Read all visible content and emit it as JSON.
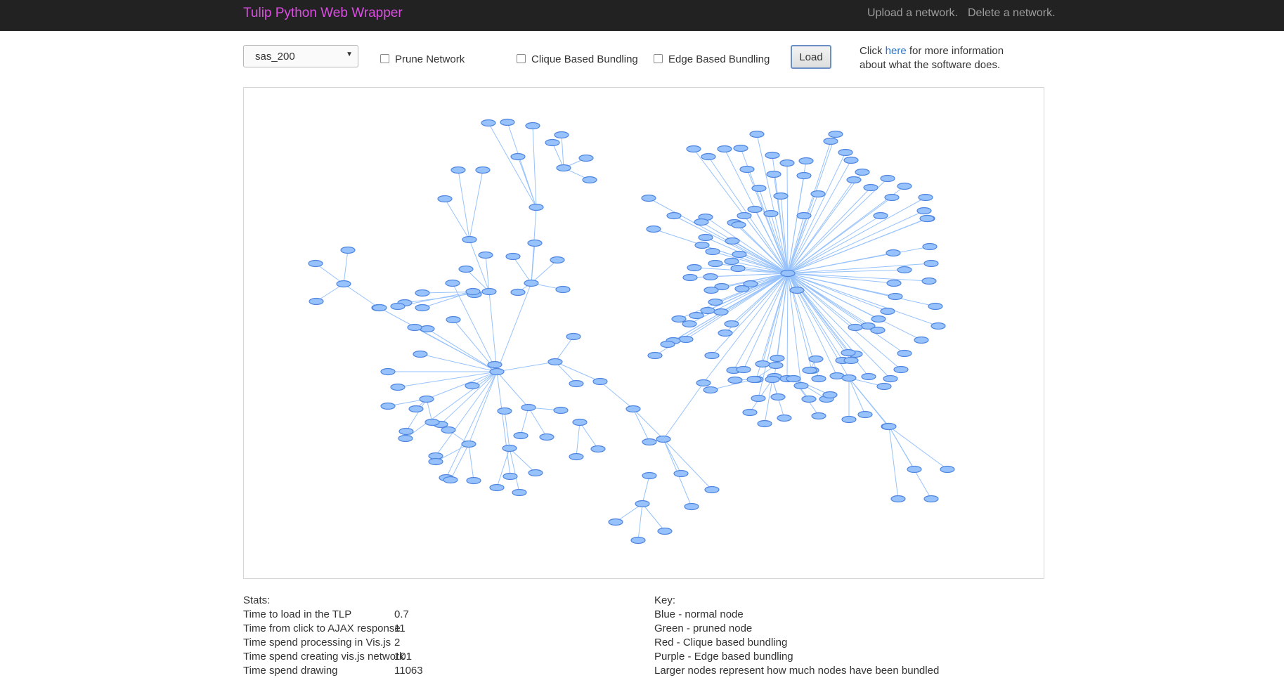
{
  "nav": {
    "brand": "Tulip Python Web Wrapper",
    "upload_label": "Upload a network.",
    "delete_label": "Delete a network."
  },
  "controls": {
    "network_select": {
      "selected": "sas_200"
    },
    "prune_label": "Prune Network",
    "clique_label": "Clique Based Bundling",
    "edge_label": "Edge Based Bundling",
    "load_label": "Load",
    "info_before": "Click",
    "info_link": "here",
    "info_after": "for more information about what the software does."
  },
  "graph": {
    "node_color": "#97c2fc",
    "node_border": "#4f86e0",
    "edge_color": "#97c2fc"
  },
  "stats": {
    "heading": "Stats:",
    "rows": [
      {
        "label": "Time to load in the TLP",
        "value": "0.7"
      },
      {
        "label": "Time from click to AJAX response",
        "value": "11"
      },
      {
        "label": "Time spend processing in Vis.js",
        "value": "2"
      },
      {
        "label": "Time spend creating vis.js network",
        "value": "101"
      },
      {
        "label": "Time spend drawing",
        "value": "11063"
      }
    ]
  },
  "key": {
    "heading": "Key:",
    "items": [
      "Blue - normal node",
      "Green - pruned node",
      "Red - Clique based bundling",
      "Purple - Edge based bundling",
      "Larger nodes represent how much nodes have been bundled"
    ]
  }
}
